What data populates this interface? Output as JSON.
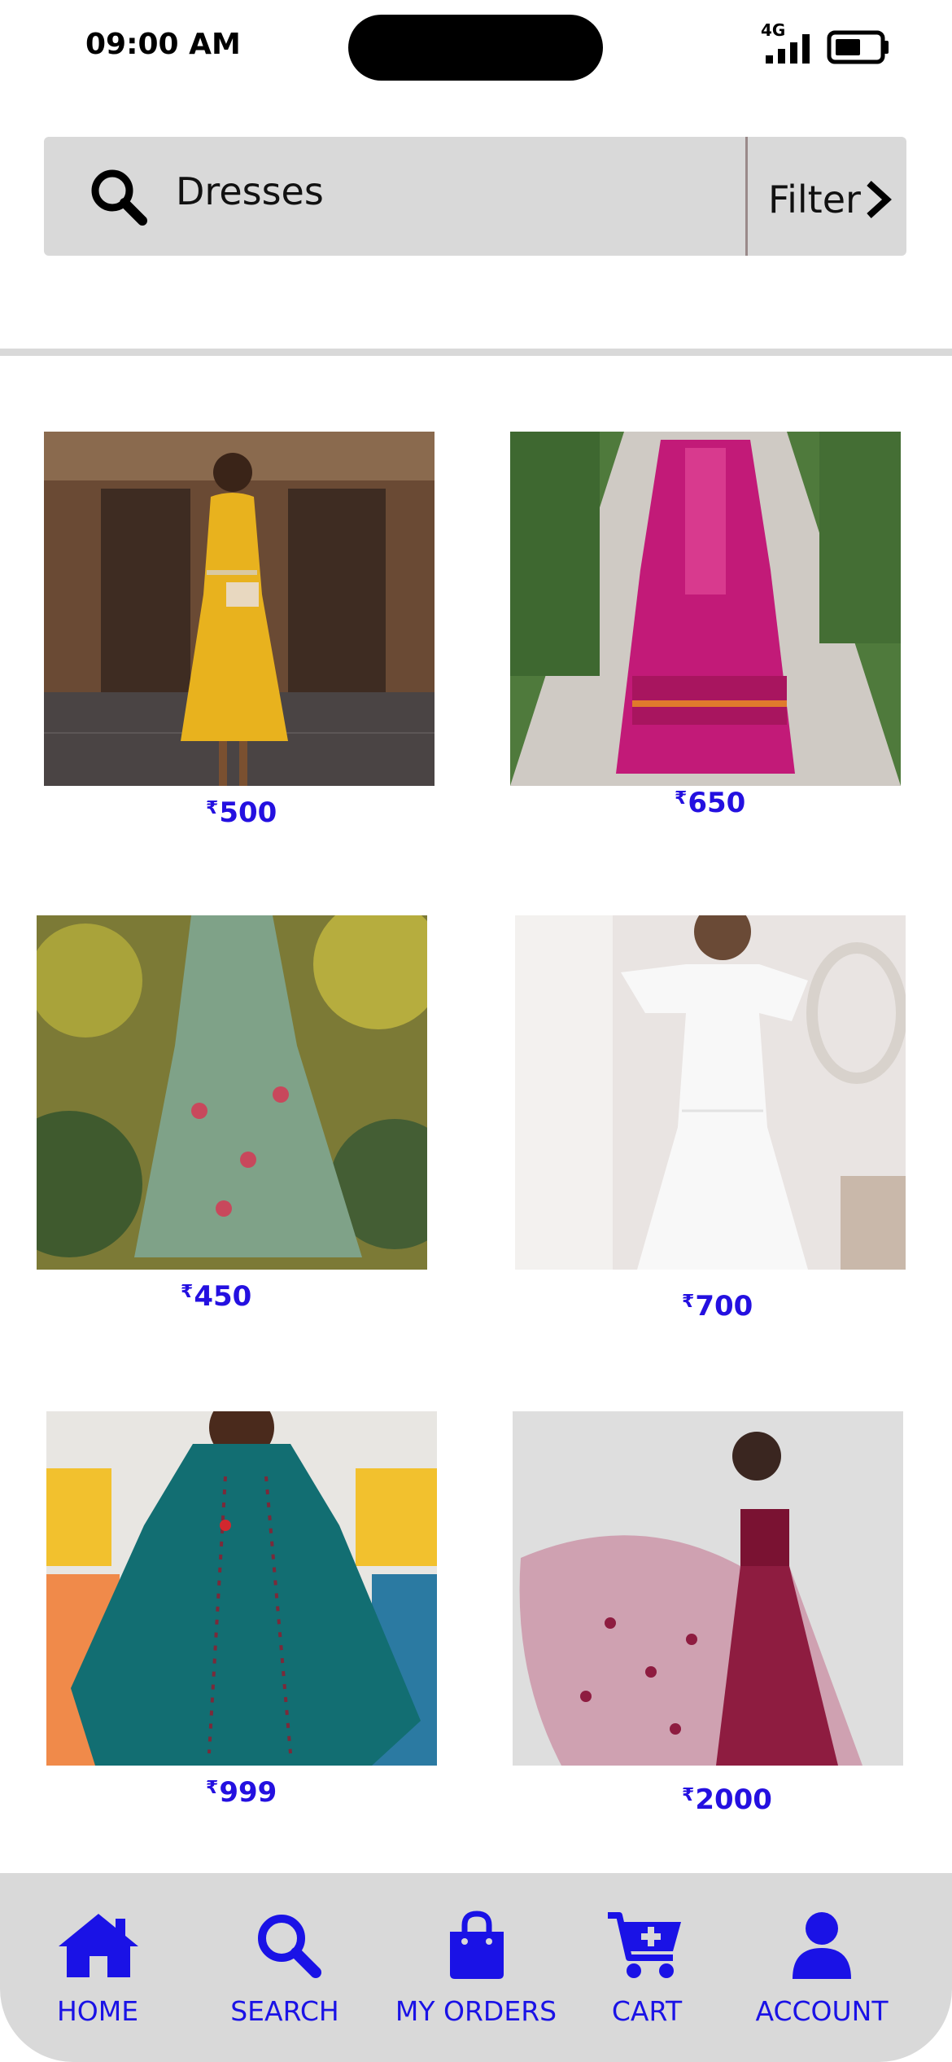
{
  "status_bar": {
    "time": "09:00 AM",
    "network": "4G"
  },
  "search": {
    "query": "Dresses",
    "filter_label": "Filter",
    "icon": "search-icon",
    "filter_icon": "chevron-right-icon"
  },
  "products": [
    {
      "currency": "₹",
      "price": "500",
      "image": "woman in yellow midi dress"
    },
    {
      "currency": "₹",
      "price": "650",
      "image": "woman in pink printed anarkali dress"
    },
    {
      "currency": "₹",
      "price": "450",
      "image": "woman in green floral maxi dress"
    },
    {
      "currency": "₹",
      "price": "700",
      "image": "girl in white flutter-sleeve dress"
    },
    {
      "currency": "₹",
      "price": "999",
      "image": "woman in teal embroidered kurta"
    },
    {
      "currency": "₹",
      "price": "2000",
      "image": "woman in maroon tulle gown"
    }
  ],
  "nav": {
    "items": [
      {
        "label": "HOME",
        "icon": "home-icon"
      },
      {
        "label": "SEARCH",
        "icon": "search-icon"
      },
      {
        "label": "MY ORDERS",
        "icon": "shopping-bag-icon"
      },
      {
        "label": "CART",
        "icon": "cart-icon"
      },
      {
        "label": "ACCOUNT",
        "icon": "person-icon"
      }
    ]
  },
  "colors": {
    "accent": "#1a12e6",
    "price": "#2410e0",
    "bar_bg": "#d9d9d9"
  }
}
